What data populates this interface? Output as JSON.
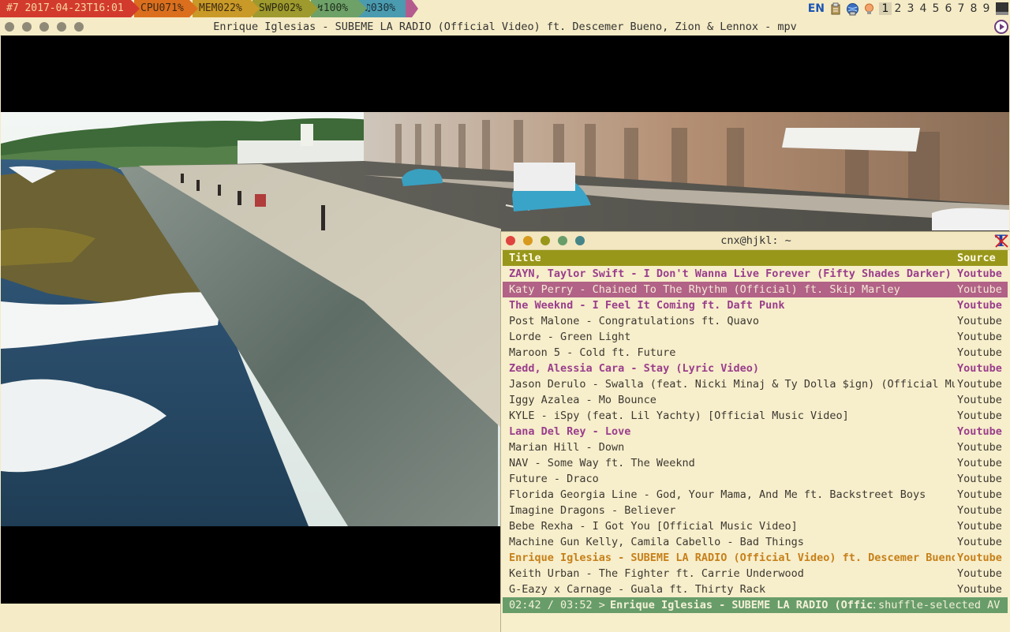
{
  "topbar": {
    "date": "#7 2017-04-23T16:01",
    "cpu": "CPU071%",
    "mem": "MEM022%",
    "swp": "SWP002%",
    "battery": "↯100%",
    "volume": "♫030%",
    "lang": "EN",
    "workspaces": [
      "1",
      "2",
      "3",
      "4",
      "5",
      "6",
      "7",
      "8",
      "9"
    ],
    "active_workspace": "1"
  },
  "mpv": {
    "title": "Enrique Iglesias - SUBEME LA RADIO (Official Video) ft. Descemer Bueno, Zion & Lennox - mpv"
  },
  "terminal": {
    "title": "cnx@hjkl: ~",
    "columns": {
      "title": "Title",
      "source": "Source"
    },
    "rows": [
      {
        "title": "ZAYN, Taylor Swift - I Don't Wanna Live Forever (Fifty Shades Darker)",
        "source": "Youtube",
        "state": "queued"
      },
      {
        "title": "Katy Perry - Chained To The Rhythm (Official) ft. Skip Marley",
        "source": "Youtube",
        "state": "selected"
      },
      {
        "title": "The Weeknd - I Feel It Coming ft. Daft Punk",
        "source": "Youtube",
        "state": "queued"
      },
      {
        "title": "Post Malone - Congratulations ft. Quavo",
        "source": "Youtube",
        "state": "normal"
      },
      {
        "title": "Lorde - Green Light",
        "source": "Youtube",
        "state": "normal"
      },
      {
        "title": "Maroon 5 - Cold ft. Future",
        "source": "Youtube",
        "state": "normal"
      },
      {
        "title": "Zedd, Alessia Cara - Stay (Lyric Video)",
        "source": "Youtube",
        "state": "queued"
      },
      {
        "title": "Jason Derulo - Swalla (feat. Nicki Minaj & Ty Dolla $ign) (Official Music Video)",
        "source": "Youtube",
        "state": "normal"
      },
      {
        "title": "Iggy Azalea - Mo Bounce",
        "source": "Youtube",
        "state": "normal"
      },
      {
        "title": "KYLE - iSpy (feat. Lil Yachty) [Official Music Video]",
        "source": "Youtube",
        "state": "normal"
      },
      {
        "title": "Lana Del Rey - Love",
        "source": "Youtube",
        "state": "queued"
      },
      {
        "title": "Marian Hill - Down",
        "source": "Youtube",
        "state": "normal"
      },
      {
        "title": "NAV - Some Way ft. The Weeknd",
        "source": "Youtube",
        "state": "normal"
      },
      {
        "title": "Future - Draco",
        "source": "Youtube",
        "state": "normal"
      },
      {
        "title": "Florida Georgia Line - God, Your Mama, And Me ft. Backstreet Boys",
        "source": "Youtube",
        "state": "normal"
      },
      {
        "title": "Imagine Dragons - Believer",
        "source": "Youtube",
        "state": "normal"
      },
      {
        "title": "Bebe Rexha - I Got You [Official Music Video]",
        "source": "Youtube",
        "state": "normal"
      },
      {
        "title": "Machine Gun Kelly, Camila Cabello - Bad Things",
        "source": "Youtube",
        "state": "normal"
      },
      {
        "title": "Enrique Iglesias - SUBEME LA RADIO (Official Video) ft. Descemer Bueno, Zion & Lennox",
        "source": "Youtube",
        "state": "playing"
      },
      {
        "title": "Keith Urban - The Fighter ft. Carrie Underwood",
        "source": "Youtube",
        "state": "normal"
      },
      {
        "title": "G-Eazy x Carnage - Guala ft. Thirty Rack",
        "source": "Youtube",
        "state": "normal"
      }
    ],
    "status": {
      "time": "02:42 / 03:52 >",
      "track": "Enrique Iglesias - SUBEME LA RADIO (Official Video) ft. Descemer Bueno, Zion & Lennox",
      "mode": "shuffle-selected AV"
    }
  }
}
